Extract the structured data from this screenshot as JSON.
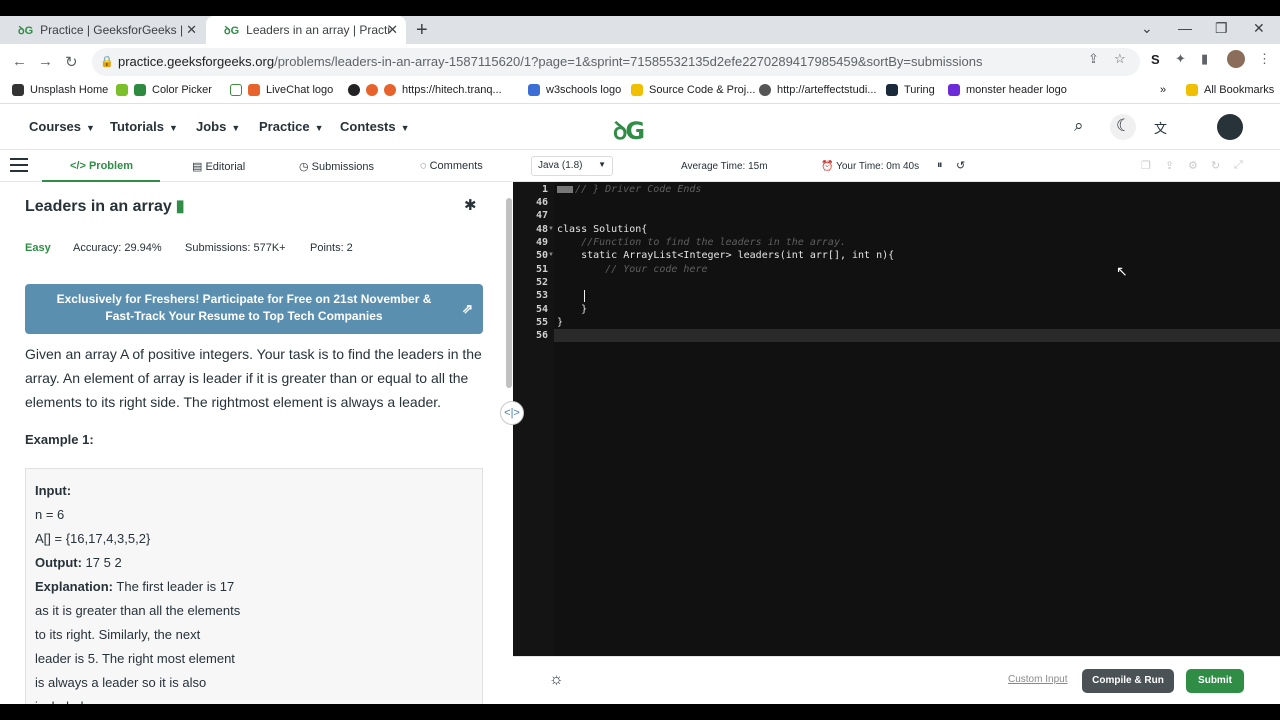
{
  "browser": {
    "tabs": [
      {
        "title": "Practice | GeeksforGeeks | A com",
        "active": false
      },
      {
        "title": "Leaders in an array | Practice | G",
        "active": true
      }
    ],
    "url_host": "practice.geeksforgeeks.org",
    "url_path": "/problems/leaders-in-an-array-1587115620/1?page=1&sprint=71585532135d2efe2270289417985459&sortBy=submissions",
    "extension_label": "S",
    "bookmarks": [
      "Unsplash Home",
      "Color Picker",
      "LiveChat logo",
      "https://hitech.tranq...",
      "w3schools logo",
      "Source Code & Proj...",
      "http://arteffectstudi...",
      "Turing",
      "monster header logo"
    ],
    "all_bookmarks": "All Bookmarks",
    "more_bookmarks": "»"
  },
  "site": {
    "nav": [
      "Courses",
      "Tutorials",
      "Jobs",
      "Practice",
      "Contests"
    ],
    "logo": "GG"
  },
  "problem": {
    "tabs": [
      "Problem",
      "Editorial",
      "Submissions",
      "Comments"
    ],
    "active_tab": "Problem",
    "title": "Leaders in an array",
    "difficulty": "Easy",
    "accuracy": "Accuracy: 29.94%",
    "submissions": "Submissions: 577K+",
    "points": "Points: 2",
    "banner": "Exclusively for Freshers! Participate for Free on 21st November & Fast-Track Your Resume to Top Tech Companies",
    "description": "Given an array A of positive integers. Your task is to find the leaders in the array. An element of array is leader if it is greater than or equal to all the elements to its right side. The rightmost element is always a leader.",
    "example_heading": "Example 1:",
    "example": {
      "input_label": "Input:",
      "n_line": "n = 6",
      "a_line": "A[] = {16,17,4,3,5,2}",
      "output_label": "Output:",
      "output_value": "17 5 2",
      "explanation_label": "Explanation:",
      "explanation_lines": [
        "The first leader is 17",
        "as it is greater than all the elements",
        "to its right.  Similarly, the next",
        "leader is 5. The right most element",
        "is always a leader so it is also",
        "included."
      ]
    }
  },
  "editor": {
    "language": "Java (1.8)",
    "average_time": "Average Time: 15m",
    "your_time": "Your Time: 0m 40s",
    "line_numbers": [
      "1",
      "46",
      "47",
      "48",
      "49",
      "50",
      "51",
      "52",
      "53",
      "54",
      "55",
      "56"
    ],
    "code_lines": [
      "// } Driver Code Ends",
      "",
      "",
      "class Solution{",
      "    //Function to find the leaders in the array.",
      "    static ArrayList<Integer> leaders(int arr[], int n){",
      "        // Your code here",
      "",
      "",
      "    }",
      "}",
      ""
    ],
    "custom_input": "Custom Input",
    "compile_run": "Compile & Run",
    "submit": "Submit"
  }
}
